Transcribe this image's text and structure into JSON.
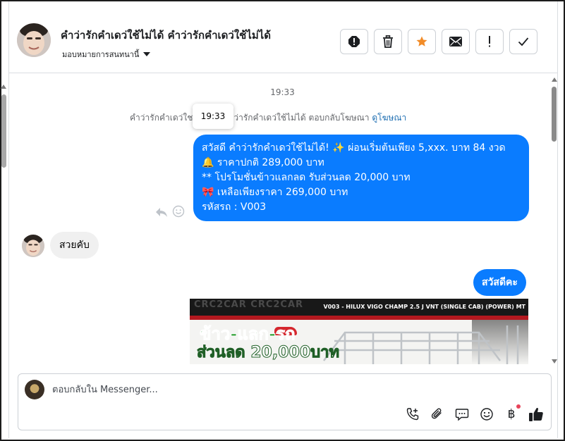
{
  "header": {
    "title": "คําว่ารักคําเดว่ใช้ไม่ได้ คําว่ารักคําเดว่ใช้ไม่ได้",
    "assign_label": "มอบหมายการสนทนานี้",
    "actions": [
      {
        "name": "spam-button",
        "icon": "exclamation-circle-icon"
      },
      {
        "name": "delete-button",
        "icon": "trash-icon"
      },
      {
        "name": "star-button",
        "icon": "star-icon"
      },
      {
        "name": "mark-unread-button",
        "icon": "envelope-icon"
      },
      {
        "name": "follow-up-button",
        "icon": "exclamation-icon"
      },
      {
        "name": "done-button",
        "icon": "check-icon"
      }
    ],
    "star_color": "#f28c28"
  },
  "thread": {
    "time_divider": "19:33",
    "ad_reply_text": "คําว่ารักคําเดว่ใช",
    "ad_reply_text2": "ว่ารักคําเดว่ใช้ไม่ได้ ตอบกลับโฆษณา",
    "ad_link": "ดูโฆษณา",
    "tooltip_time": "19:33",
    "outgoing_message": {
      "lines": [
        "สวัสดี คําว่ารักคําเดว่ใช้ไม่ได้! ✨  ผ่อนเริ่มต้นเพียง 5,xxx. บาท 84 งวด",
        "🔔 ราคาปกติ 289,000 บาท",
        "** โปรโมชั่นข้าวแลกลด รับส่วนลด 20,000 บาท",
        "🎀  เหลือเพียงราคา 269,000 บาท",
        " รหัสรถ : V003"
      ]
    },
    "incoming_message": "สวยคับ",
    "outgoing_message_2": "สวัสดีคะ",
    "promo_image": {
      "brand": "CRC2CAR CRC2CAR",
      "model": "V003 - HILUX VIGO CHAMP 2.5 J VNT (SINGLE CAB) (POWER) MT",
      "headline": "ข้าว-แลก-รถ",
      "discount": "ส่วนลด 20,000บาท"
    },
    "bubble_color": "#0a7cff"
  },
  "composer": {
    "placeholder": "ตอบกลับใน Messenger...",
    "tools": [
      "phone-plus-icon",
      "paperclip-icon",
      "chat-bubble-icon",
      "smiley-icon",
      "baht-icon",
      "thumbs-up-icon"
    ],
    "baht_symbol": "฿"
  }
}
